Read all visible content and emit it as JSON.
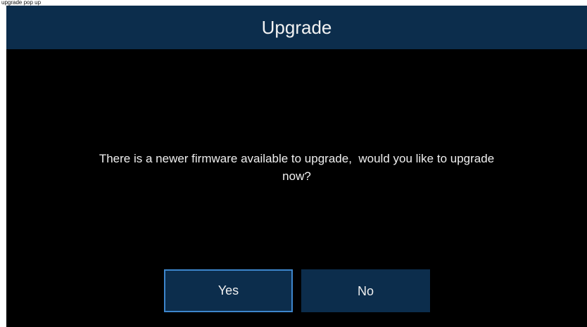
{
  "top_caption": "upgrade pop up",
  "dialog": {
    "title": "Upgrade",
    "message_line1": "There is a newer firmware available to upgrade,  would you like to upgrade",
    "message_line2": "now?",
    "yes_label": "Yes",
    "no_label": "No",
    "selected_button": "Yes"
  },
  "colors": {
    "title_bar": "#0c2d4c",
    "dialog_background": "#000000",
    "button_background": "#0c2d4c",
    "selected_border": "#3d86cc",
    "text": "#f0f0f0"
  }
}
